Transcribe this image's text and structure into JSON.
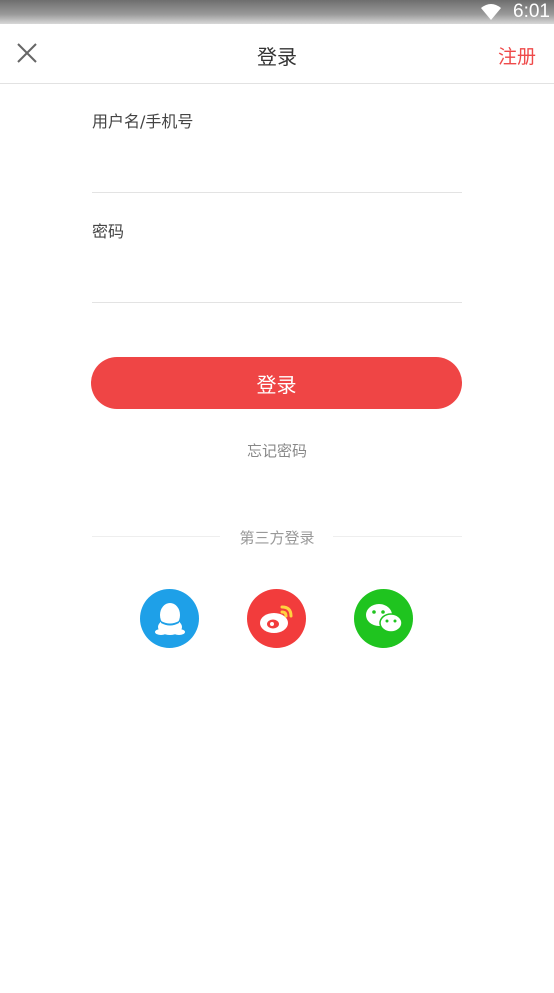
{
  "status_bar": {
    "time": "6:01"
  },
  "header": {
    "title": "登录",
    "register_label": "注册"
  },
  "form": {
    "username_label": "用户名/手机号",
    "password_label": "密码"
  },
  "login_button": {
    "label": "登录"
  },
  "forgot_password": "忘记密码",
  "third_party": {
    "label": "第三方登录",
    "providers": [
      "qq-icon",
      "weibo-icon",
      "wechat-icon"
    ]
  },
  "colors": {
    "accent": "#ef4545",
    "qq": "#1ea0e8",
    "weibo": "#f23c3c",
    "wechat": "#1fc41f"
  }
}
